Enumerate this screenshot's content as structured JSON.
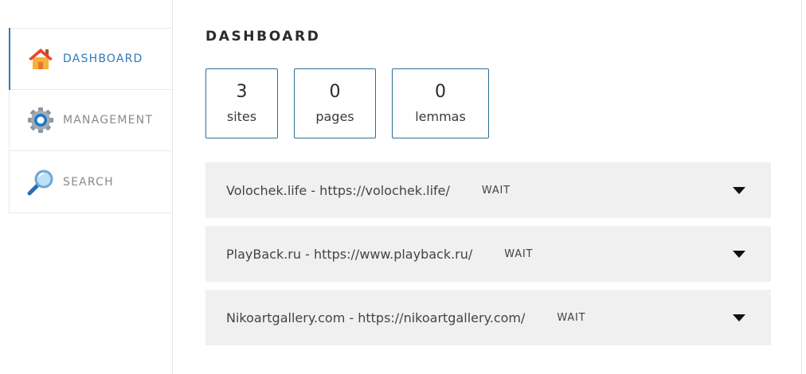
{
  "sidebar": {
    "items": [
      {
        "label": "DASHBOARD",
        "icon": "home-icon",
        "active": true
      },
      {
        "label": "MANAGEMENT",
        "icon": "gear-icon",
        "active": false
      },
      {
        "label": "SEARCH",
        "icon": "magnifier-icon",
        "active": false
      }
    ]
  },
  "main": {
    "title": "DASHBOARD",
    "stats": [
      {
        "value": "3",
        "label": "sites"
      },
      {
        "value": "0",
        "label": "pages"
      },
      {
        "value": "0",
        "label": "lemmas"
      }
    ],
    "sites": [
      {
        "name": "Volochek.life - https://volochek.life/",
        "status": "WAIT"
      },
      {
        "name": "PlayBack.ru - https://www.playback.ru/",
        "status": "WAIT"
      },
      {
        "name": "Nikoartgallery.com - https://nikoartgallery.com/",
        "status": "WAIT"
      }
    ]
  },
  "colors": {
    "accent": "#2f79b9",
    "stat_border": "#2c6f95",
    "row_background": "#f0f0f0"
  }
}
